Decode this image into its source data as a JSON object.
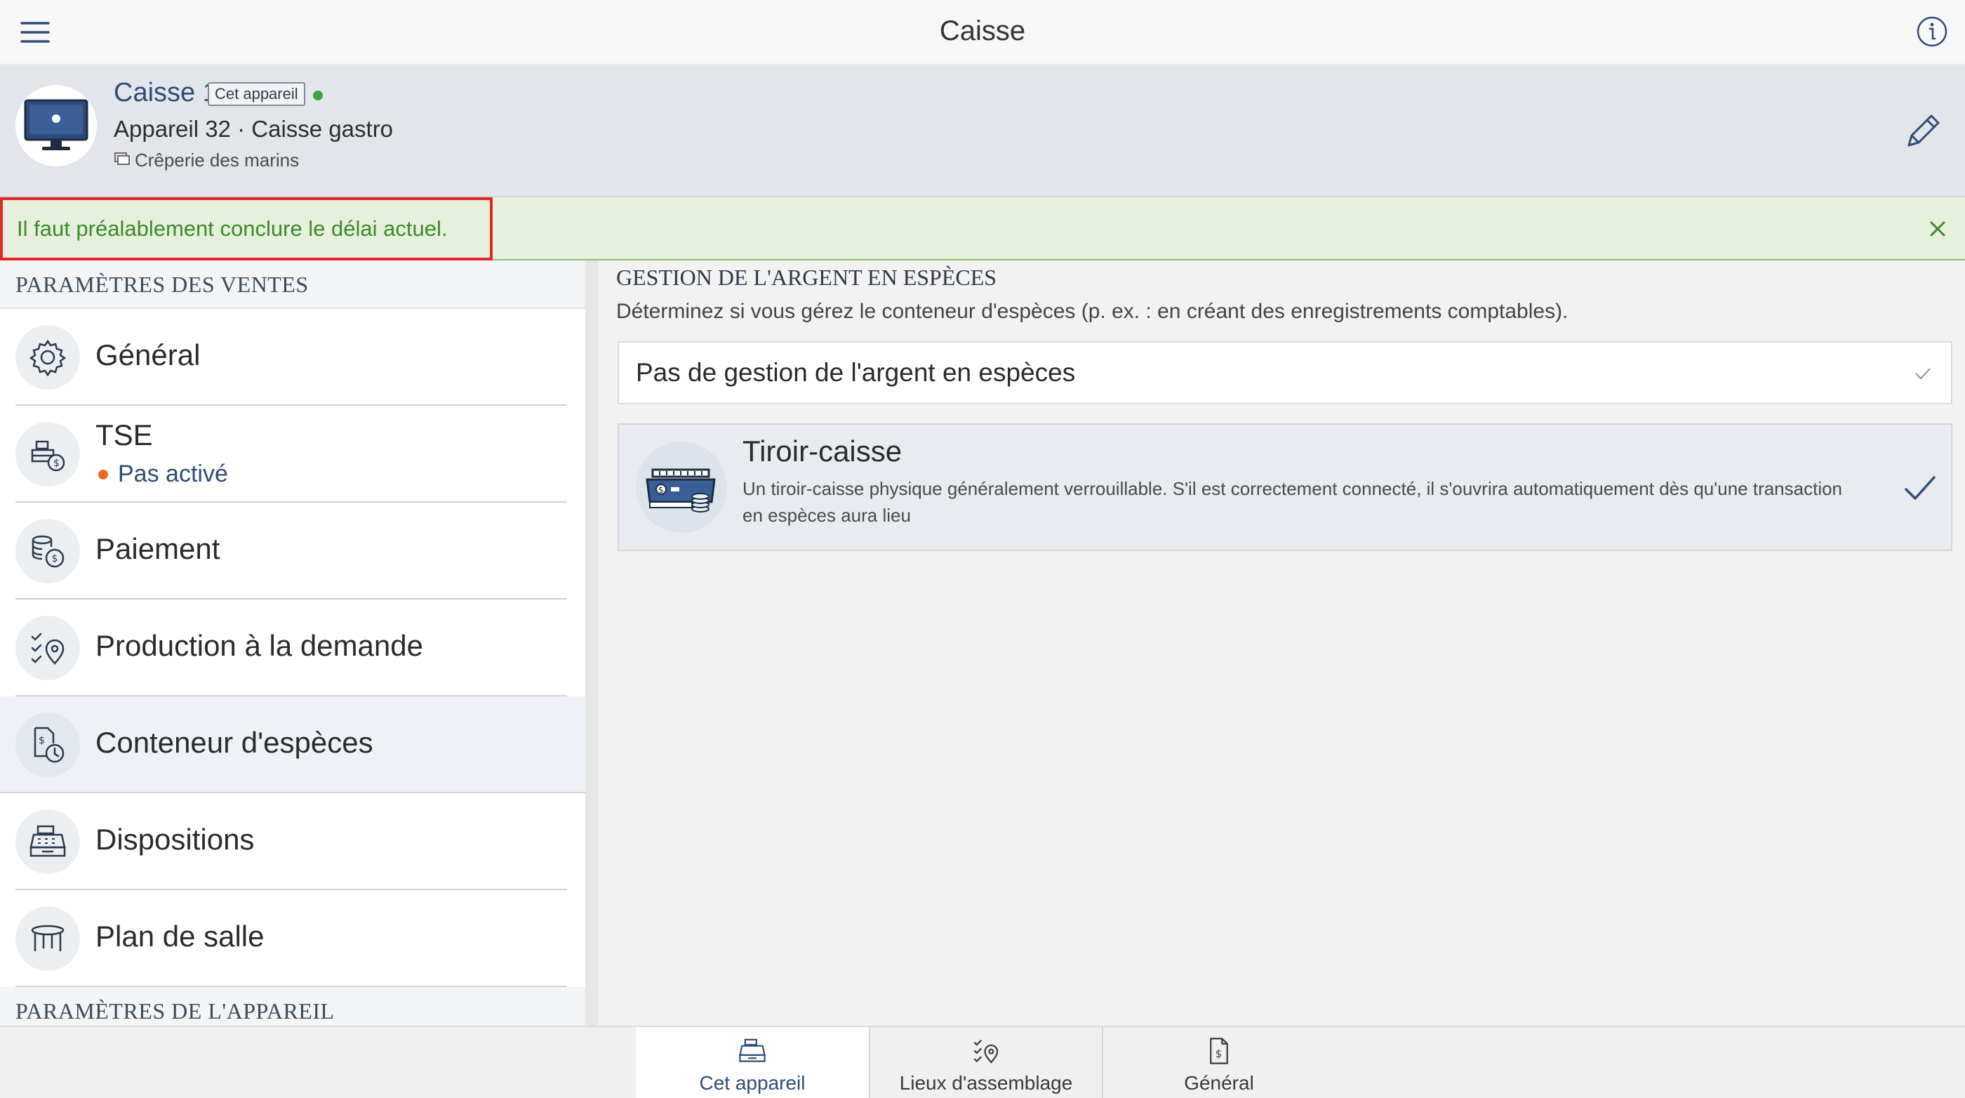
{
  "topbar": {
    "title": "Caisse",
    "menu_icon": "hamburger-icon",
    "info_icon": "info-icon"
  },
  "device": {
    "name": "Caisse 1",
    "badge": "Cet appareil",
    "online_color": "#3fa33f",
    "subtitle": "Appareil 32 · Caisse gastro",
    "location": "Crêperie des marins"
  },
  "notice": {
    "message": "Il faut préalablement conclure le délai actuel."
  },
  "left": {
    "section_sales": "PARAMÈTRES DES VENTES",
    "items": [
      {
        "label": "Général",
        "icon": "gear-icon"
      },
      {
        "label": "TSE",
        "icon": "register-coin-icon",
        "status": "Pas activé",
        "status_color": "#ee6a21"
      },
      {
        "label": "Paiement",
        "icon": "payment-icon"
      },
      {
        "label": "Production à la demande",
        "icon": "checklist-location-icon"
      },
      {
        "label": "Conteneur d'espèces",
        "icon": "cash-container-clock-icon",
        "active": true
      },
      {
        "label": "Dispositions",
        "icon": "cash-register-icon"
      },
      {
        "label": "Plan de salle",
        "icon": "table-icon"
      }
    ],
    "section_device": "PARAMÈTRES DE L'APPAREIL"
  },
  "right": {
    "heading": "GESTION DE L'ARGENT EN ESPÈCES",
    "description": "Déterminez si vous gérez le conteneur d'espèces (p. ex. : en créant des enregistrements comptables).",
    "option_none": "Pas de gestion de l'argent en espèces",
    "option_drawer_title": "Tiroir-caisse",
    "option_drawer_desc": "Un tiroir-caisse physique généralement verrouillable. S'il est correctement connecté, il s'ouvrira automatiquement dès qu'une transaction en espèces aura lieu"
  },
  "tabs": [
    {
      "label": "Cet appareil",
      "icon": "cash-register-icon",
      "selected": true
    },
    {
      "label": "Lieux d'assemblage",
      "icon": "checklist-location-icon"
    },
    {
      "label": "Général",
      "icon": "document-dollar-icon"
    }
  ],
  "colors": {
    "accent": "#2f4d78",
    "notice_text": "#3c8a2a",
    "highlight_border": "#e02828"
  }
}
